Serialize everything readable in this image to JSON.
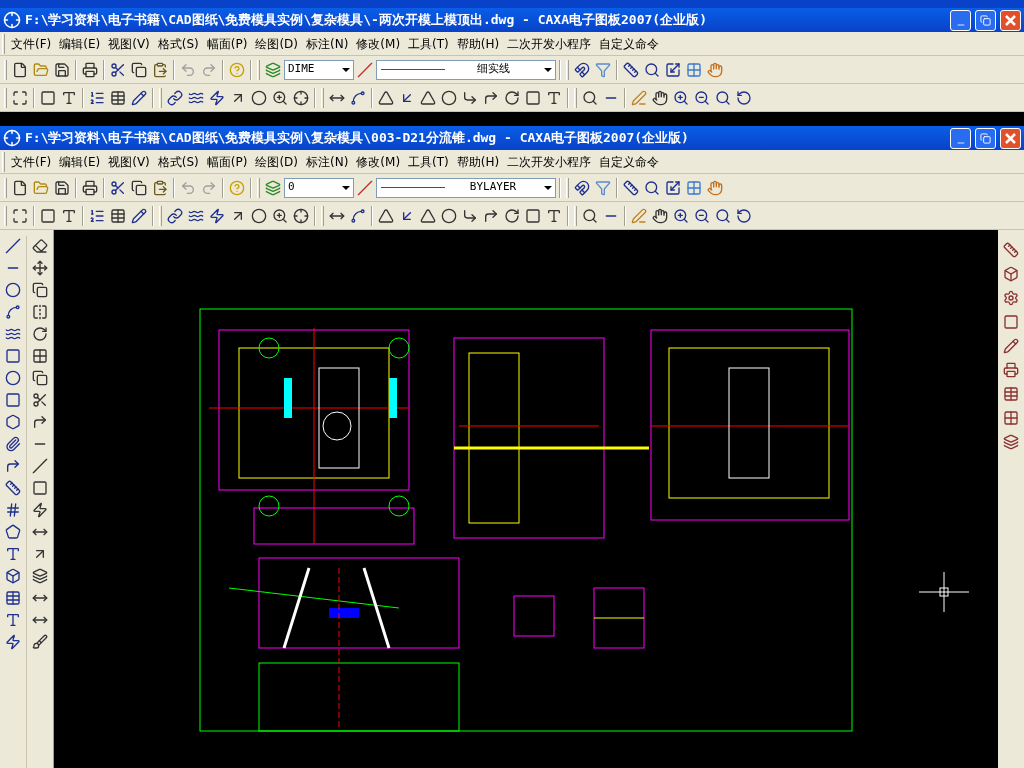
{
  "windows": [
    {
      "title": "F:\\学习资料\\电子书籍\\CAD图纸\\免费模具实例\\复杂模具\\-两次开模上模顶出.dwg - CAXA电子图板2007(企业版)",
      "menu": [
        "文件(F)",
        "编辑(E)",
        "视图(V)",
        "格式(S)",
        "幅面(P)",
        "绘图(D)",
        "标注(N)",
        "修改(M)",
        "工具(T)",
        "帮助(H)",
        "二次开发小程序",
        "自定义命令"
      ],
      "layer": "DIME",
      "linetype": "细实线"
    },
    {
      "title": "F:\\学习资料\\电子书籍\\CAD图纸\\免费模具实例\\复杂模具\\003-D21分流锥.dwg - CAXA电子图板2007(企业版)",
      "menu": [
        "文件(F)",
        "编辑(E)",
        "视图(V)",
        "格式(S)",
        "幅面(P)",
        "绘图(D)",
        "标注(N)",
        "修改(M)",
        "工具(T)",
        "帮助(H)",
        "二次开发小程序",
        "自定义命令"
      ],
      "layer": "0",
      "linetype": "BYLAYER"
    }
  ]
}
